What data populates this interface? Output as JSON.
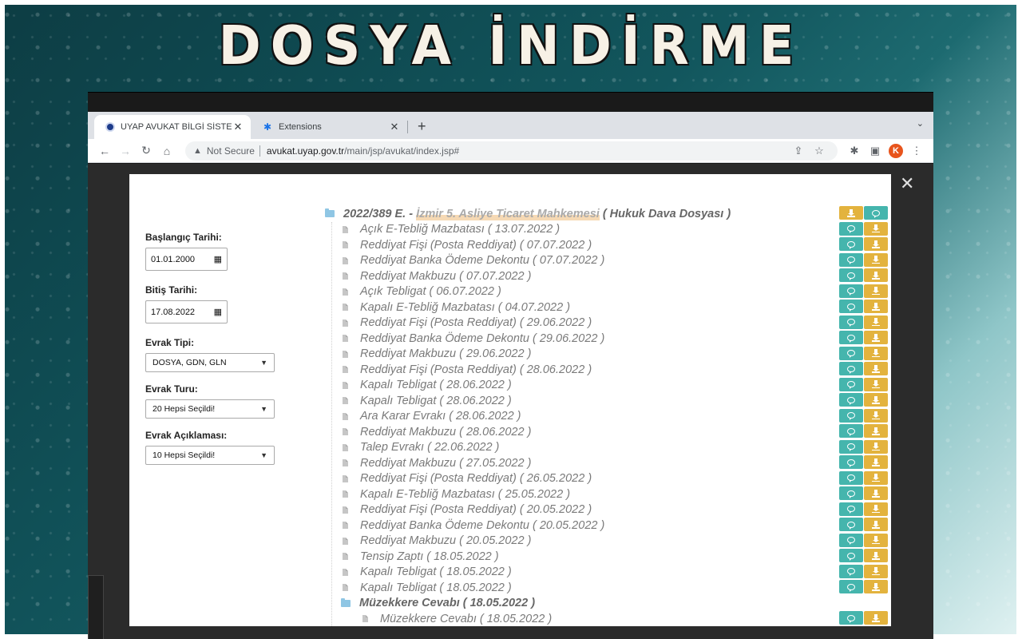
{
  "banner": {
    "title": "DOSYA İNDİRME"
  },
  "browser": {
    "tabs": [
      {
        "label": "UYAP AVUKAT BİLGİ SİSTEMİ",
        "active": true
      },
      {
        "label": "Extensions",
        "active": false
      }
    ],
    "new_tab": "+",
    "security_label": "Not Secure",
    "url_host": "avukat.uyap.gov.tr",
    "url_path": "/main/jsp/avukat/index.jsp#",
    "profile_initial": "K"
  },
  "filters": {
    "start_label": "Başlangıç Tarihi:",
    "start_value": "01.01.2000",
    "end_label": "Bitiş Tarihi:",
    "end_value": "17.08.2022",
    "evrak_tipi_label": "Evrak Tipi:",
    "evrak_tipi_value": "DOSYA, GDN, GLN",
    "evrak_turu_label": "Evrak Turu:",
    "evrak_turu_value": "20 Hepsi Seçildi!",
    "evrak_aciklamasi_label": "Evrak Açıklaması:",
    "evrak_aciklamasi_value": "10 Hepsi Seçildi!"
  },
  "tree": {
    "root": {
      "prefix": "2022/389 E. - ",
      "court": "İzmir 5. Asliye Ticaret Mahkemesi",
      "suffix": " ( Hukuk Dava Dosyası )"
    },
    "items": [
      "Açık E-Tebliğ Mazbatası ( 13.07.2022 )",
      "Reddiyat Fişi (Posta Reddiyat) ( 07.07.2022 )",
      "Reddiyat Banka Ödeme Dekontu ( 07.07.2022 )",
      "Reddiyat Makbuzu ( 07.07.2022 )",
      "Açık Tebligat ( 06.07.2022 )",
      "Kapalı E-Tebliğ Mazbatası ( 04.07.2022 )",
      "Reddiyat Fişi (Posta Reddiyat) ( 29.06.2022 )",
      "Reddiyat Banka Ödeme Dekontu ( 29.06.2022 )",
      "Reddiyat Makbuzu ( 29.06.2022 )",
      "Reddiyat Fişi (Posta Reddiyat) ( 28.06.2022 )",
      "Kapalı Tebligat ( 28.06.2022 )",
      "Kapalı Tebligat ( 28.06.2022 )",
      "Ara Karar Evrakı ( 28.06.2022 )",
      "Reddiyat Makbuzu ( 28.06.2022 )",
      "Talep Evrakı ( 22.06.2022 )",
      "Reddiyat Makbuzu ( 27.05.2022 )",
      "Reddiyat Fişi (Posta Reddiyat) ( 26.05.2022 )",
      "Kapalı E-Tebliğ Mazbatası ( 25.05.2022 )",
      "Reddiyat Fişi (Posta Reddiyat) ( 20.05.2022 )",
      "Reddiyat Banka Ödeme Dekontu ( 20.05.2022 )",
      "Reddiyat Makbuzu ( 20.05.2022 )",
      "Tensip Zaptı ( 18.05.2022 )",
      "Kapalı Tebligat ( 18.05.2022 )",
      "Kapalı Tebligat ( 18.05.2022 )"
    ],
    "subfolder": "Müzekkere Cevabı ( 18.05.2022 )",
    "subitems": [
      "Müzekkere Cevabı ( 18.05.2022 )"
    ]
  },
  "colors": {
    "teal": "#45b5ad",
    "gold": "#e3b33e"
  }
}
